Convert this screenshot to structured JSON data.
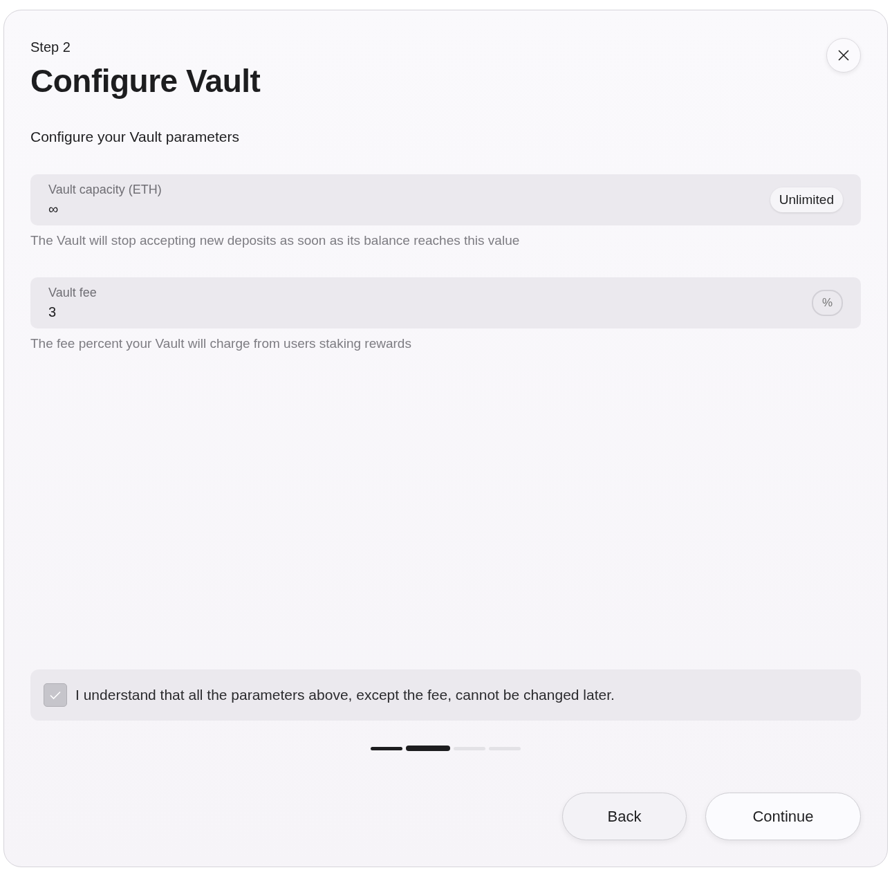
{
  "dialog": {
    "step": "Step 2",
    "title": "Configure Vault",
    "subtitle": "Configure your Vault parameters"
  },
  "fields": [
    {
      "label": "Vault capacity (ETH)",
      "value": "∞",
      "kind": "pill",
      "addon": "Unlimited",
      "hint": "The Vault will stop accepting new deposits as soon as its balance reaches this value"
    },
    {
      "label": "Vault fee",
      "value": "3",
      "kind": "unit",
      "addon": "%",
      "hint": "The fee percent your Vault will charge from users staking rewards"
    }
  ],
  "agreement": {
    "text": "I understand that all the parameters above, except the fee, cannot be changed later.",
    "checked": true,
    "disabled": true
  },
  "progress": [
    {
      "completed": true,
      "selected": false
    },
    {
      "completed": false,
      "selected": true
    },
    {
      "completed": false,
      "selected": false
    },
    {
      "completed": false,
      "selected": false
    }
  ],
  "buttons": [
    {
      "label": "Back",
      "kind": "secondary"
    },
    {
      "label": "Continue",
      "kind": "primary"
    }
  ]
}
